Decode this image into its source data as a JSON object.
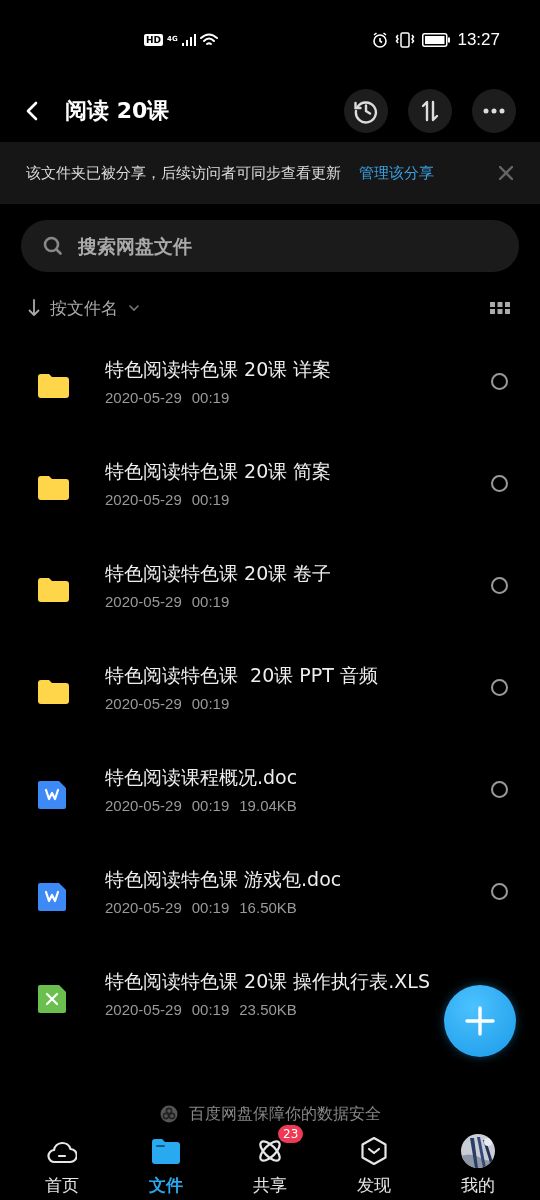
{
  "status_bar": {
    "hd": "HD",
    "network": "4G",
    "time": "13:27"
  },
  "header": {
    "title": "阅读 20课"
  },
  "banner": {
    "text": "该文件夹已被分享，后续访问者可同步查看更新",
    "link": "管理该分享"
  },
  "search": {
    "placeholder": "搜索网盘文件"
  },
  "sort": {
    "label": "按文件名"
  },
  "files": [
    {
      "kind": "folder",
      "name": "特色阅读特色课 20课 详案",
      "date": "2020-05-29",
      "time": "00:19",
      "checked": false
    },
    {
      "kind": "folder",
      "name": "特色阅读特色课 20课 简案",
      "date": "2020-05-29",
      "time": "00:19",
      "checked": false
    },
    {
      "kind": "folder",
      "name": "特色阅读特色课 20课 卷子",
      "date": "2020-05-29",
      "time": "00:19",
      "checked": false
    },
    {
      "kind": "folder",
      "name": "特色阅读特色课  20课 PPT 音频",
      "date": "2020-05-29",
      "time": "00:19",
      "checked": false
    },
    {
      "kind": "doc",
      "name": "特色阅读课程概况.doc",
      "date": "2020-05-29",
      "time": "00:19",
      "size": "19.04KB",
      "checked": false
    },
    {
      "kind": "doc",
      "name": "特色阅读特色课 游戏包.doc",
      "date": "2020-05-29",
      "time": "00:19",
      "size": "16.50KB",
      "checked": false
    },
    {
      "kind": "xls",
      "name": "特色阅读特色课 20课 操作执行表.XLS",
      "date": "2020-05-29",
      "time": "00:19",
      "size": "23.50KB"
    }
  ],
  "footer_note": "百度网盘保障你的数据安全",
  "tabs": [
    {
      "kind": "home",
      "label": "首页",
      "selected": false
    },
    {
      "kind": "files",
      "label": "文件",
      "selected": true
    },
    {
      "kind": "share",
      "label": "共享",
      "selected": false,
      "badge": "23"
    },
    {
      "kind": "discover",
      "label": "发现",
      "selected": false
    },
    {
      "kind": "me",
      "label": "我的",
      "selected": false
    }
  ]
}
